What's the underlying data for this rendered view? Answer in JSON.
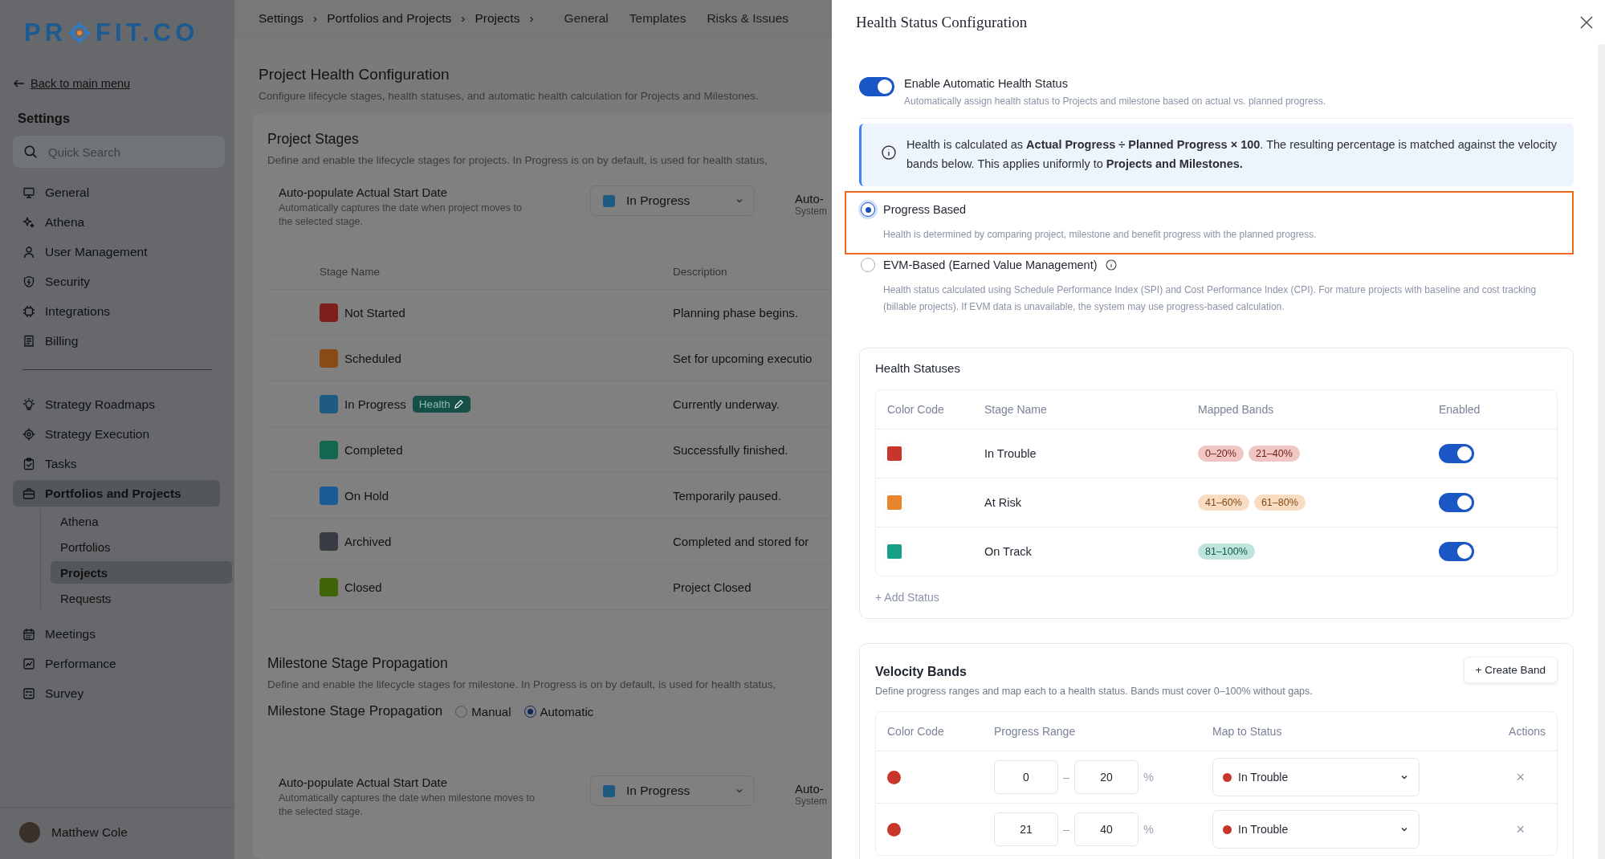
{
  "sidebar": {
    "logo": {
      "left": "PR",
      "right": "FIT.CO"
    },
    "back_link": "Back to main menu",
    "heading": "Settings",
    "search": {
      "placeholder": "Quick Search"
    },
    "groups": [
      {
        "items": [
          {
            "label": "General",
            "selected": false
          },
          {
            "label": "Athena",
            "selected": false
          },
          {
            "label": "User Management",
            "selected": false
          },
          {
            "label": "Security",
            "selected": false
          },
          {
            "label": "Integrations",
            "selected": false
          },
          {
            "label": "Billing",
            "selected": false
          }
        ]
      },
      {
        "items": [
          {
            "label": "Strategy Roadmaps",
            "selected": false
          },
          {
            "label": "Strategy Execution",
            "selected": false
          },
          {
            "label": "Tasks",
            "selected": false
          },
          {
            "label": "Portfolios and Projects",
            "selected": true,
            "children": [
              {
                "label": "Athena",
                "selected": false
              },
              {
                "label": "Portfolios",
                "selected": false
              },
              {
                "label": "Projects",
                "selected": true
              },
              {
                "label": "Requests",
                "selected": false
              }
            ]
          },
          {
            "label": "Meetings",
            "selected": false
          },
          {
            "label": "Performance",
            "selected": false
          },
          {
            "label": "Survey",
            "selected": false
          }
        ]
      }
    ],
    "user": {
      "name": "Matthew Cole"
    }
  },
  "main": {
    "breadcrumb": {
      "separator": "›",
      "items": [
        "Settings",
        "Portfolios and Projects",
        "Projects"
      ]
    },
    "tabs": [
      {
        "label": "General",
        "selected": false
      },
      {
        "label": "Templates",
        "selected": false
      },
      {
        "label": "Risks & Issues",
        "selected": false
      }
    ],
    "title": "Project Health Configuration",
    "subtitle": "Configure lifecycle stages, health statuses, and automatic health calculation for Projects and Milestones.",
    "stages": {
      "title": "Project Stages",
      "description": "Define and enable the lifecycle stages for projects. In Progress is on by default, is used for health status,",
      "auto_populate": {
        "label": "Auto-populate Actual Start Date",
        "description": "Automatically captures the date when project moves to the selected stage.",
        "dropdown": {
          "value": "In Progress",
          "color": "#1f5a82"
        },
        "next_label": "Auto-",
        "next_description": "System"
      },
      "columns": [
        "Stage Name",
        "Description"
      ],
      "rows": [
        {
          "name": "Not Started",
          "color": "#7f1f1c",
          "description": "Planning phase begins."
        },
        {
          "name": "Scheduled",
          "color": "#8a4a15",
          "description": "Set for upcoming executio"
        },
        {
          "name": "In Progress",
          "color": "#1f5a82",
          "description": "Currently underway.",
          "badge": "Health"
        },
        {
          "name": "Completed",
          "color": "#146650",
          "description": "Successfully finished."
        },
        {
          "name": "On Hold",
          "color": "#1b5c96",
          "description": "Temporarily paused."
        },
        {
          "name": "Archived",
          "color": "#383d45",
          "description": "Completed and stored for"
        },
        {
          "name": "Closed",
          "color": "#3f6309",
          "description": "Project Closed"
        }
      ]
    },
    "milestone": {
      "title": "Milestone Stage Propagation",
      "description": "Define and enable the lifecycle stages for milestone. In Progress is on by default, is used for health status,",
      "propagation": {
        "label": "Milestone Stage Propagation",
        "options": [
          {
            "label": "Manual",
            "selected": false
          },
          {
            "label": "Automatic",
            "selected": true
          }
        ]
      },
      "auto_populate": {
        "label": "Auto-populate Actual Start Date",
        "description": "Automatically captures the date when milestone moves to the selected stage.",
        "dropdown": {
          "value": "In Progress",
          "color": "#1f5a82"
        },
        "next_label": "Auto-",
        "next_description": "System"
      }
    }
  },
  "drawer": {
    "title": "Health Status Configuration",
    "auto_toggle": {
      "label": "Enable Automatic Health Status",
      "description": "Automatically assign health status to Projects and milestone based on actual vs. planned progress.",
      "on": true
    },
    "info": "Health is calculated as **Actual Progress ÷ Planned Progress × 100**. The resulting percentage is matched against the velocity bands below. This applies uniformly to **Projects and Milestones.**",
    "methods": [
      {
        "label": "Progress Based",
        "description": "Health is determined by comparing project, milestone and benefit progress with the planned progress.",
        "selected": true,
        "highlighted": true,
        "info_icon": false
      },
      {
        "label": "EVM-Based (Earned Value Management)",
        "description": "Health status calculated using Schedule Performance Index (SPI) and Cost Performance Index (CPI). For mature projects with baseline and cost tracking (billable projects). If EVM data is unavailable, the system may use progress-based calculation.",
        "selected": false,
        "highlighted": false,
        "info_icon": true
      }
    ],
    "health_statuses": {
      "title": "Health Statuses",
      "columns": [
        "Color Code",
        "Stage Name",
        "Mapped Bands",
        "Enabled"
      ],
      "rows": [
        {
          "color": "#c8352a",
          "name": "In Trouble",
          "bands": [
            "0–20%",
            "21–40%"
          ],
          "enabled": true
        },
        {
          "color": "#e8842a",
          "name": "At Risk",
          "bands": [
            "41–60%",
            "61–80%"
          ],
          "enabled": true
        },
        {
          "color": "#17a085",
          "name": "On Track",
          "bands": [
            "81–100%"
          ],
          "enabled": true
        }
      ],
      "add": "+ Add Status"
    },
    "velocity_bands": {
      "title": "Velocity Bands",
      "description": "Define progress ranges and map each to a health status. Bands must cover 0–100% without gaps.",
      "button": "+ Create Band",
      "columns": [
        "Color Code",
        "Progress Range",
        "Map to Status",
        "Actions"
      ],
      "rows": [
        {
          "color": "#c8352a",
          "from": "0",
          "separator": "–",
          "to": "20",
          "unit": "%",
          "status": {
            "label": "In Trouble",
            "color": "#c8352a"
          },
          "action": "×"
        },
        {
          "color": "#c8352a",
          "from": "21",
          "separator": "–",
          "to": "40",
          "unit": "%",
          "status": {
            "label": "In Trouble",
            "color": "#c8352a"
          },
          "action": "×"
        }
      ]
    }
  }
}
